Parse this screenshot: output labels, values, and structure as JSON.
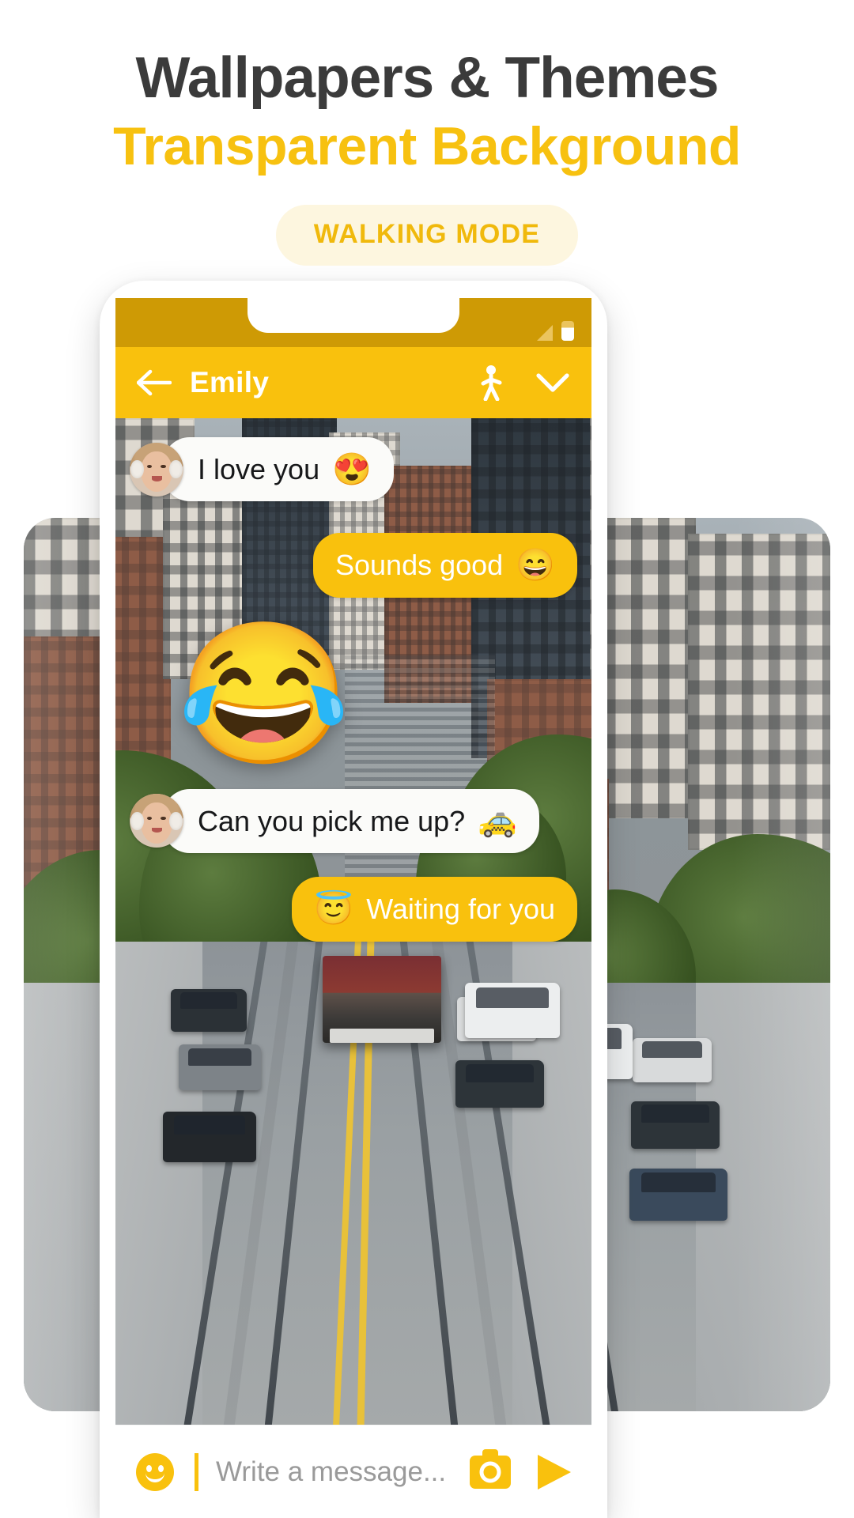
{
  "promo": {
    "headline_line1": "Wallpapers & Themes",
    "headline_line2": "Transparent Background",
    "badge_label": "WALKING MODE",
    "colors": {
      "headline_dark": "#3B3B3B",
      "headline_accent": "#F7C110",
      "badge_bg": "#FDF6DF",
      "badge_text": "#F0B90C"
    }
  },
  "phone": {
    "statusbar": {
      "signal_icon": "signal-bars-icon",
      "battery_icon": "battery-icon"
    },
    "appbar": {
      "back_icon": "back-arrow-icon",
      "contact_name": "Emily",
      "walking_icon": "walking-person-icon",
      "chevron_icon": "chevron-down-icon",
      "bg_color": "#F9C10D"
    },
    "chat": {
      "wallpaper_name": "san-francisco-cable-car-street",
      "messages": [
        {
          "id": "msg-1",
          "direction": "in",
          "avatar": "emily-avatar",
          "text": "I love you",
          "emoji": "😍",
          "emoji_name": "heart-eyes-emoji"
        },
        {
          "id": "msg-2",
          "direction": "out",
          "text": "Sounds good",
          "emoji": "😄",
          "emoji_name": "grinning-smiling-eyes-emoji"
        },
        {
          "id": "msg-3",
          "direction": "sticker",
          "emoji": "😂",
          "emoji_name": "tears-of-joy-emoji"
        },
        {
          "id": "msg-4",
          "direction": "in",
          "avatar": "emily-avatar",
          "text": "Can you pick me up?",
          "emoji": "🚕",
          "emoji_name": "taxi-emoji"
        },
        {
          "id": "msg-5",
          "direction": "out-emoji-first",
          "text": "Waiting for you",
          "emoji": "😇",
          "emoji_name": "halo-smiling-emoji"
        }
      ]
    },
    "composer": {
      "emoji_icon": "smiley-face-icon",
      "input_placeholder": "Write a message...",
      "input_value": "",
      "camera_icon": "camera-icon",
      "send_icon": "send-arrow-icon"
    }
  }
}
